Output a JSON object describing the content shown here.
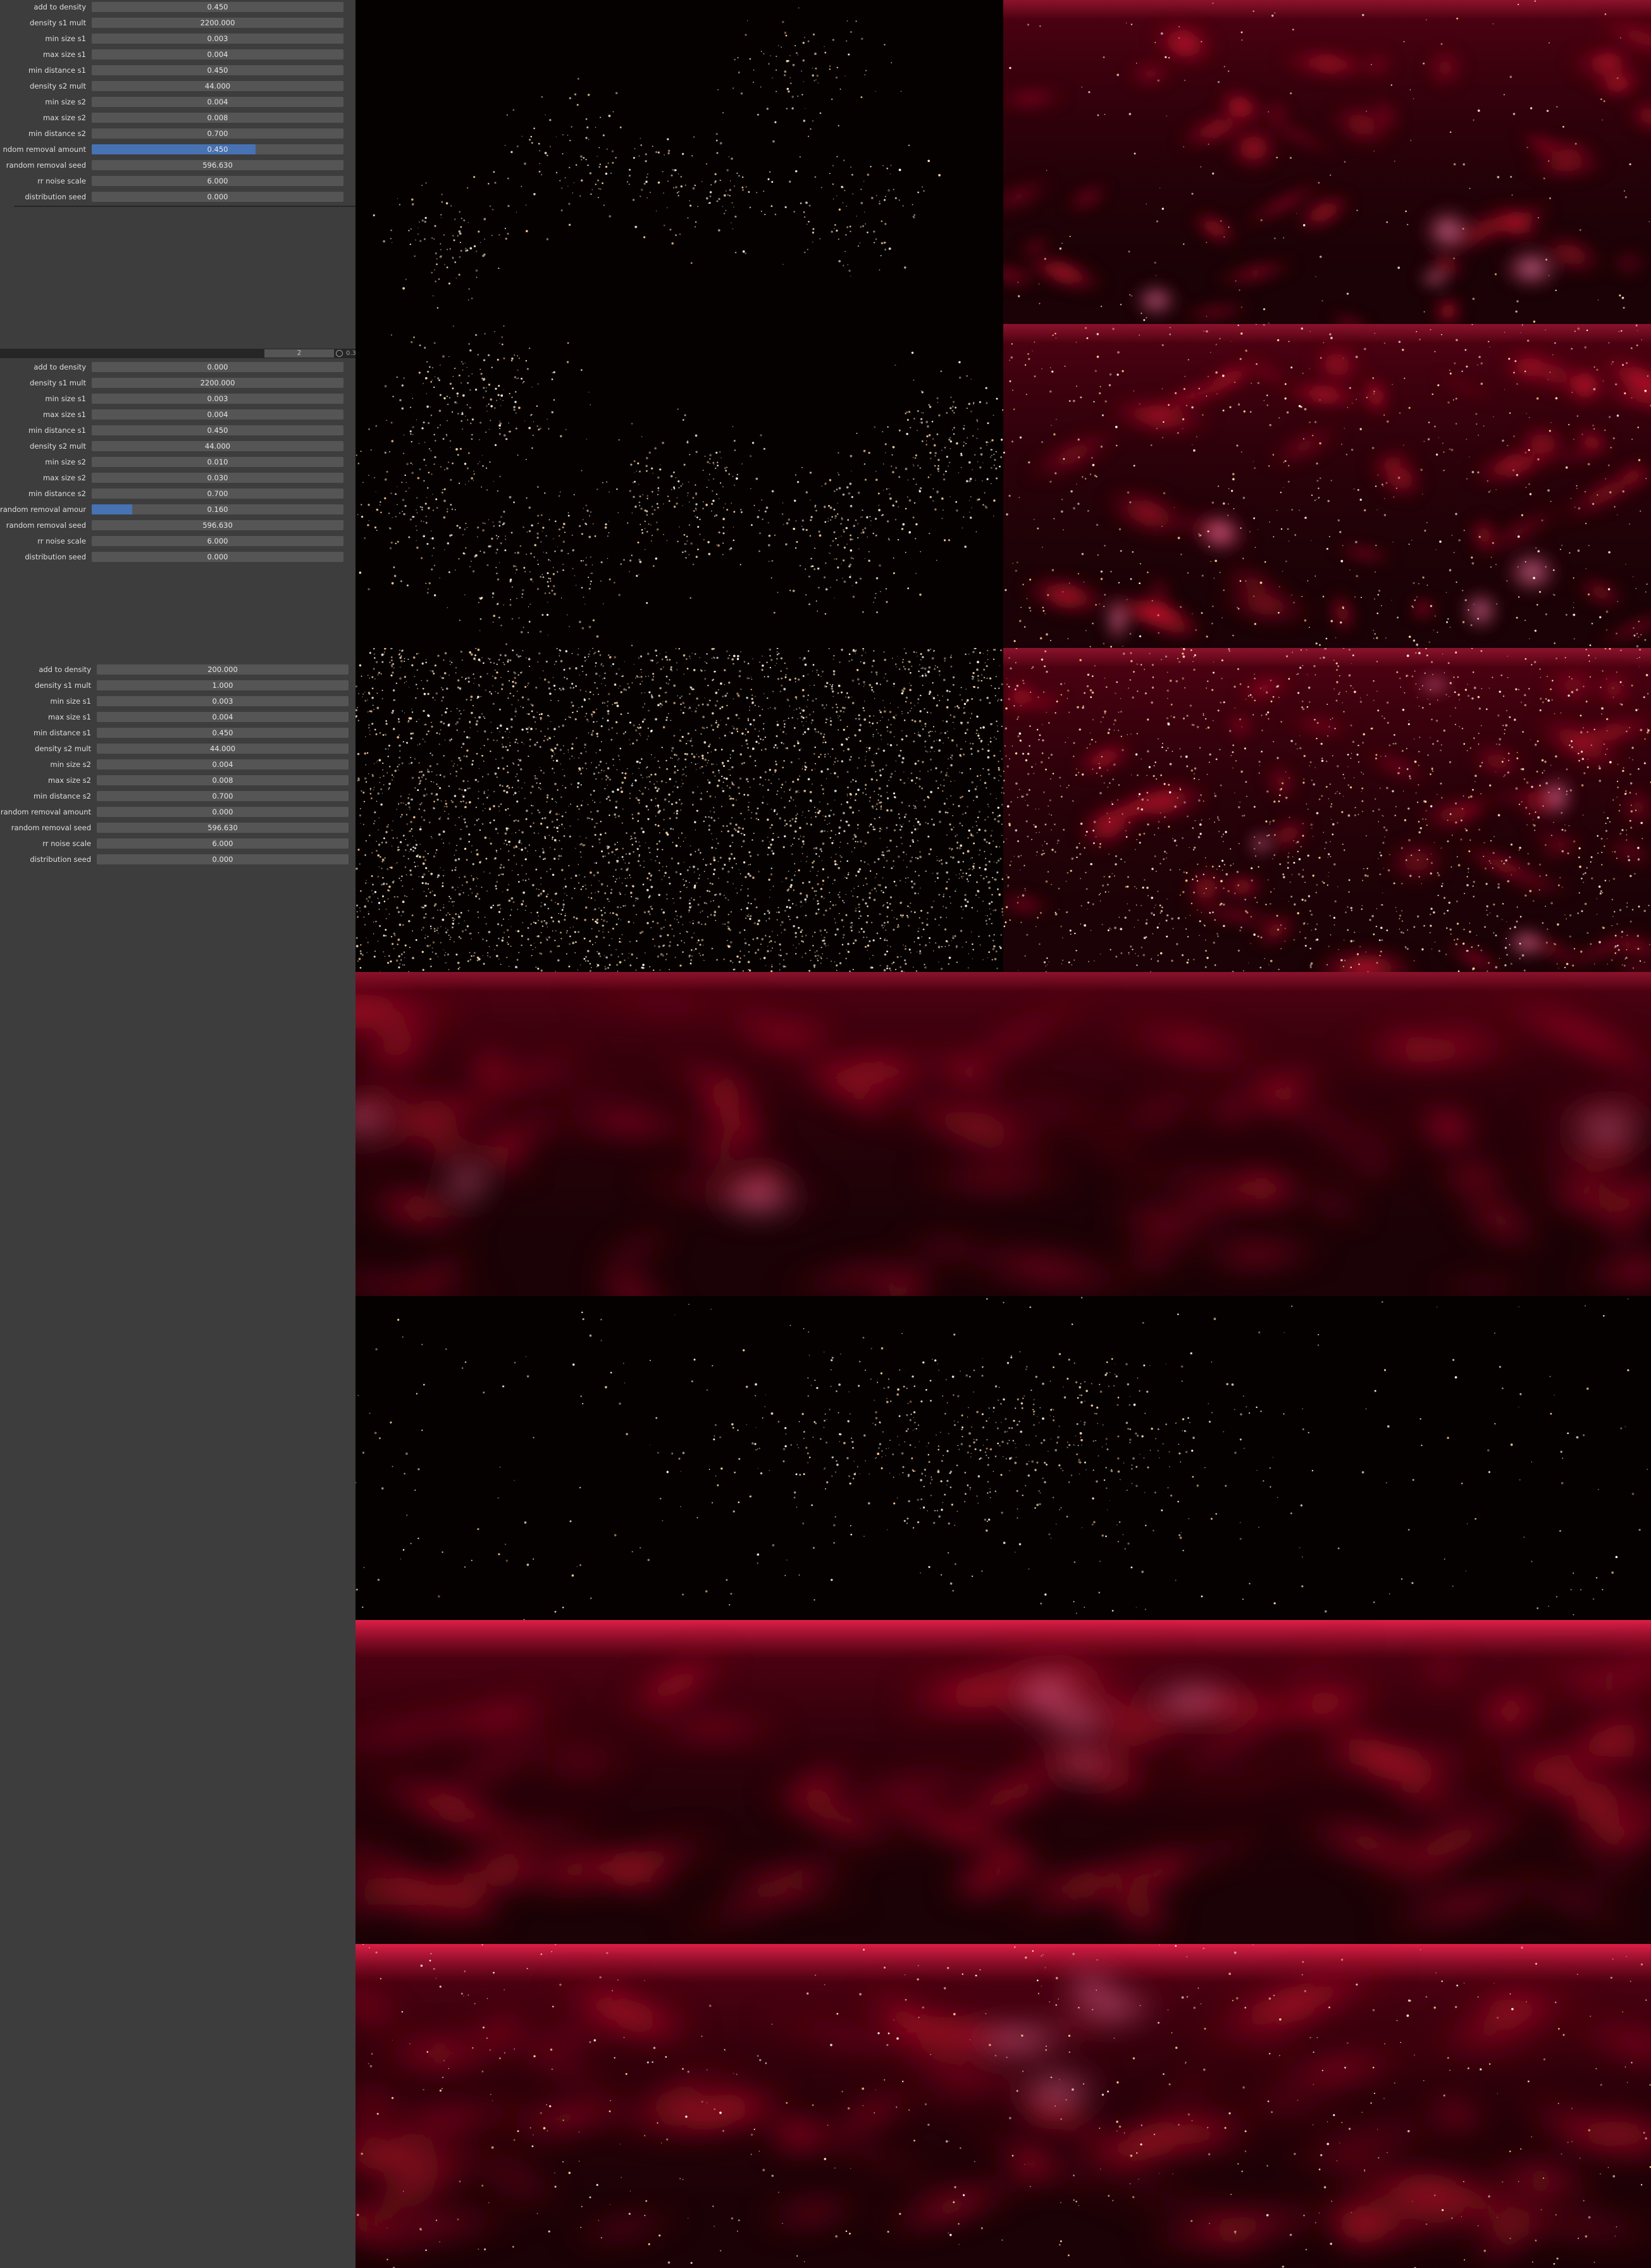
{
  "panels": [
    {
      "rows": [
        {
          "label": "add to density",
          "value": "0.450"
        },
        {
          "label": "density s1 mult",
          "value": "2200.000"
        },
        {
          "label": "min size s1",
          "value": "0.003"
        },
        {
          "label": "max size s1",
          "value": "0.004"
        },
        {
          "label": "min distance s1",
          "value": "0.450"
        },
        {
          "label": "density s2 mult",
          "value": "44.000"
        },
        {
          "label": "min size s2",
          "value": "0.004"
        },
        {
          "label": "max size s2",
          "value": "0.008"
        },
        {
          "label": "min distance s2",
          "value": "0.700"
        },
        {
          "label": "ndom removal amount",
          "value": "0.450",
          "fill": 0.65
        },
        {
          "label": "random removal seed",
          "value": "596.630"
        },
        {
          "label": "rr noise scale",
          "value": "6.000"
        },
        {
          "label": "distribution seed",
          "value": "0.000"
        }
      ]
    },
    {
      "header": {
        "number": "2",
        "tail": "0.3"
      },
      "rows": [
        {
          "label": "add to density",
          "value": "0.000"
        },
        {
          "label": "density s1 mult",
          "value": "2200.000"
        },
        {
          "label": "min size s1",
          "value": "0.003"
        },
        {
          "label": "max size s1",
          "value": "0.004"
        },
        {
          "label": "min distance s1",
          "value": "0.450"
        },
        {
          "label": "density s2 mult",
          "value": "44.000"
        },
        {
          "label": "min size s2",
          "value": "0.010"
        },
        {
          "label": "max size s2",
          "value": "0.030"
        },
        {
          "label": "min distance s2",
          "value": "0.700"
        },
        {
          "label": "random removal amount",
          "value": "0.160",
          "fill": 0.16
        },
        {
          "label": "random removal seed",
          "value": "596.630"
        },
        {
          "label": "rr noise scale",
          "value": "6.000"
        },
        {
          "label": "distribution seed",
          "value": "0.000"
        }
      ]
    },
    {
      "rows": [
        {
          "label": "add to density",
          "value": "200.000"
        },
        {
          "label": "density s1 mult",
          "value": "1.000"
        },
        {
          "label": "min size s1",
          "value": "0.003"
        },
        {
          "label": "max size s1",
          "value": "0.004"
        },
        {
          "label": "min distance s1",
          "value": "0.450"
        },
        {
          "label": "density s2 mult",
          "value": "44.000"
        },
        {
          "label": "min size s2",
          "value": "0.004"
        },
        {
          "label": "max size s2",
          "value": "0.008"
        },
        {
          "label": "min distance s2",
          "value": "0.700"
        },
        {
          "label": "random removal amount",
          "value": "0.000"
        },
        {
          "label": "random removal seed",
          "value": "596.630"
        },
        {
          "label": "rr noise scale",
          "value": "6.000"
        },
        {
          "label": "distribution seed",
          "value": "0.000"
        }
      ]
    }
  ],
  "colors": {
    "panel_bg": "#3d3d3d",
    "field_bg": "#555555",
    "slider_fill": "#4772b3",
    "nebula_red": "#e0102a",
    "nebula_pink": "#ff6ba0",
    "star_warm": "#ffe2b0"
  },
  "renders": [
    {
      "kind": "stars",
      "pattern": "clustered-sparse"
    },
    {
      "kind": "nebula-stars",
      "pattern": "sparse"
    },
    {
      "kind": "stars",
      "pattern": "clustered"
    },
    {
      "kind": "nebula-stars",
      "pattern": "medium"
    },
    {
      "kind": "stars",
      "pattern": "uniform-dense"
    },
    {
      "kind": "nebula-stars",
      "pattern": "dense"
    },
    {
      "kind": "nebula",
      "pattern": "panorama"
    },
    {
      "kind": "stars",
      "pattern": "central-band"
    },
    {
      "kind": "nebula",
      "pattern": "top-glow"
    },
    {
      "kind": "nebula-stars",
      "pattern": "top-glow"
    }
  ]
}
